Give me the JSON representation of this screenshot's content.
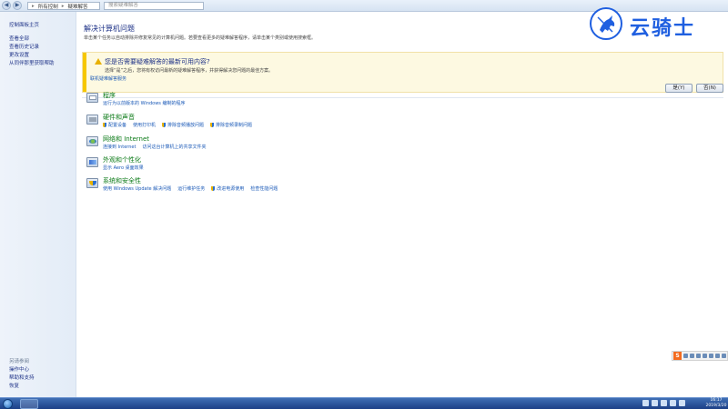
{
  "address_bar": {
    "breadcrumb": [
      "所有控制",
      "疑难解答"
    ],
    "search_placeholder": "搜索疑难解答"
  },
  "left_pane": {
    "home_link": "控制面板主页",
    "links": [
      "查看全部",
      "查看历史记录",
      "更改设置",
      "从同伴那里获取帮助"
    ],
    "see_also_heading": "另请参阅",
    "see_also": [
      "操作中心",
      "帮助和支持",
      "恢复"
    ]
  },
  "main": {
    "title": "解决计算机问题",
    "description": "单击某个任务以自动排除并修复常见的计算机问题。若要查看更多的疑难解答程序，请单击某个类别或使用搜索框。",
    "banner": {
      "title": "您是否需要疑难解答的最新可用内容?",
      "text": "选择“是”之后，您将有权访问最新的疑难解答程序，并获得解决您问题的最佳方案。",
      "link": "联机疑难解答服务",
      "yes_button": "是(Y)",
      "no_button": "否(N)"
    },
    "categories": [
      {
        "title": "程序",
        "links": [
          "运行为以前版本的 Windows 编制的程序"
        ]
      },
      {
        "title": "硬件和声音",
        "links": [
          "配置设备",
          "使用打印机",
          "排除音频播放问题",
          "排除音频录制问题"
        ]
      },
      {
        "title": "网络和 Internet",
        "links": [
          "连接到 Internet",
          "访问这台计算机上的共享文件夹"
        ]
      },
      {
        "title": "外观和个性化",
        "links": [
          "显示 Aero 桌面效果"
        ]
      },
      {
        "title": "系统和安全性",
        "links": [
          "使用 Windows Update 解决问题",
          "运行维护任务",
          "改进电源使用",
          "检查性能问题"
        ]
      }
    ]
  },
  "watermark": {
    "text": "云骑士"
  },
  "ime": {
    "label": "S"
  },
  "taskbar": {
    "clock_time": "16:17",
    "clock_date": "2019/3/20"
  },
  "icons": {
    "back": "back-arrow-icon",
    "forward": "forward-arrow-icon",
    "warning": "warning-triangle-icon",
    "shield": "uac-shield-icon"
  },
  "colors": {
    "category_title": "#0b7a17",
    "link": "#1a59b7",
    "heading": "#1e3287",
    "banner_bg": "#fdf9e1",
    "banner_accent": "#f6c700",
    "watermark": "#1f5fe0"
  }
}
